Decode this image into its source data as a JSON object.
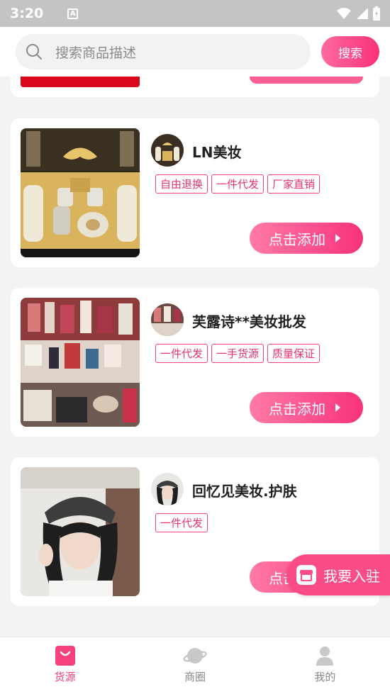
{
  "status_bar": {
    "time": "3:20",
    "notification_icon": "A"
  },
  "search": {
    "placeholder": "搜索商品描述",
    "button_label": "搜索"
  },
  "shops": [
    {
      "name": "LN美妆",
      "tags": [
        "自由退换",
        "一件代发",
        "厂家直销"
      ],
      "button_label": "点击添加"
    },
    {
      "name": "芙露诗**美妆批发",
      "tags": [
        "一件代发",
        "一手货源",
        "质量保证"
      ],
      "button_label": "点击添加"
    },
    {
      "name": "回忆见美妆.护肤",
      "tags": [
        "一件代发"
      ],
      "button_label": "点击添加"
    }
  ],
  "floating_button": {
    "label": "我要入驻"
  },
  "tabbar": {
    "items": [
      {
        "label": "货源",
        "icon": "bag-icon",
        "active": true
      },
      {
        "label": "商圈",
        "icon": "planet-icon",
        "active": false
      },
      {
        "label": "我的",
        "icon": "user-icon",
        "active": false
      }
    ]
  },
  "colors": {
    "accent": "#f5417f",
    "button_gradient_start": "#ff7aa8",
    "button_gradient_end": "#f8327a"
  }
}
